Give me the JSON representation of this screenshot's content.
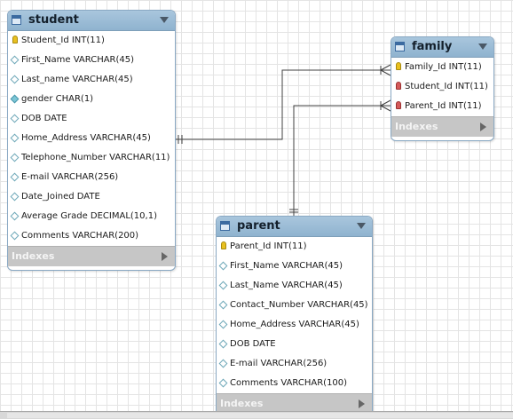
{
  "tables": {
    "student": {
      "title": "student",
      "footer": "Indexes",
      "columns": [
        {
          "text": "Student_Id INT(11)",
          "icon": "primary-key-icon"
        },
        {
          "text": "First_Name VARCHAR(45)",
          "icon": "column-nullable-icon"
        },
        {
          "text": "Last_name VARCHAR(45)",
          "icon": "column-nullable-icon"
        },
        {
          "text": "gender CHAR(1)",
          "icon": "column-not-null-icon"
        },
        {
          "text": "DOB DATE",
          "icon": "column-nullable-icon"
        },
        {
          "text": "Home_Address VARCHAR(45)",
          "icon": "column-nullable-icon"
        },
        {
          "text": "Telephone_Number VARCHAR(11)",
          "icon": "column-nullable-icon"
        },
        {
          "text": "E-mail VARCHAR(256)",
          "icon": "column-nullable-icon"
        },
        {
          "text": "Date_Joined DATE",
          "icon": "column-nullable-icon"
        },
        {
          "text": "Average Grade DECIMAL(10,1)",
          "icon": "column-nullable-icon"
        },
        {
          "text": "Comments VARCHAR(200)",
          "icon": "column-nullable-icon"
        }
      ]
    },
    "family": {
      "title": "family",
      "footer": "Indexes",
      "columns": [
        {
          "text": "Family_Id INT(11)",
          "icon": "primary-key-icon"
        },
        {
          "text": "Student_Id INT(11)",
          "icon": "foreign-key-icon"
        },
        {
          "text": "Parent_Id INT(11)",
          "icon": "foreign-key-icon"
        }
      ]
    },
    "parent": {
      "title": "parent",
      "footer": "Indexes",
      "columns": [
        {
          "text": "Parent_Id INT(11)",
          "icon": "primary-key-icon"
        },
        {
          "text": "First_Name VARCHAR(45)",
          "icon": "column-nullable-icon"
        },
        {
          "text": "Last_Name VARCHAR(45)",
          "icon": "column-nullable-icon"
        },
        {
          "text": "Contact_Number VARCHAR(45)",
          "icon": "column-nullable-icon"
        },
        {
          "text": "Home_Address VARCHAR(45)",
          "icon": "column-nullable-icon"
        },
        {
          "text": "DOB DATE",
          "icon": "column-nullable-icon"
        },
        {
          "text": "E-mail VARCHAR(256)",
          "icon": "column-nullable-icon"
        },
        {
          "text": "Comments VARCHAR(100)",
          "icon": "column-nullable-icon"
        }
      ]
    }
  },
  "relationships": [
    {
      "from": "student",
      "to": "family",
      "from_cardinality": "one",
      "to_cardinality": "many"
    },
    {
      "from": "parent",
      "to": "family",
      "from_cardinality": "one",
      "to_cardinality": "many"
    }
  ],
  "colors": {
    "header": "#a9c6dd",
    "footer": "#c6c6c6",
    "connector": "#404040"
  }
}
